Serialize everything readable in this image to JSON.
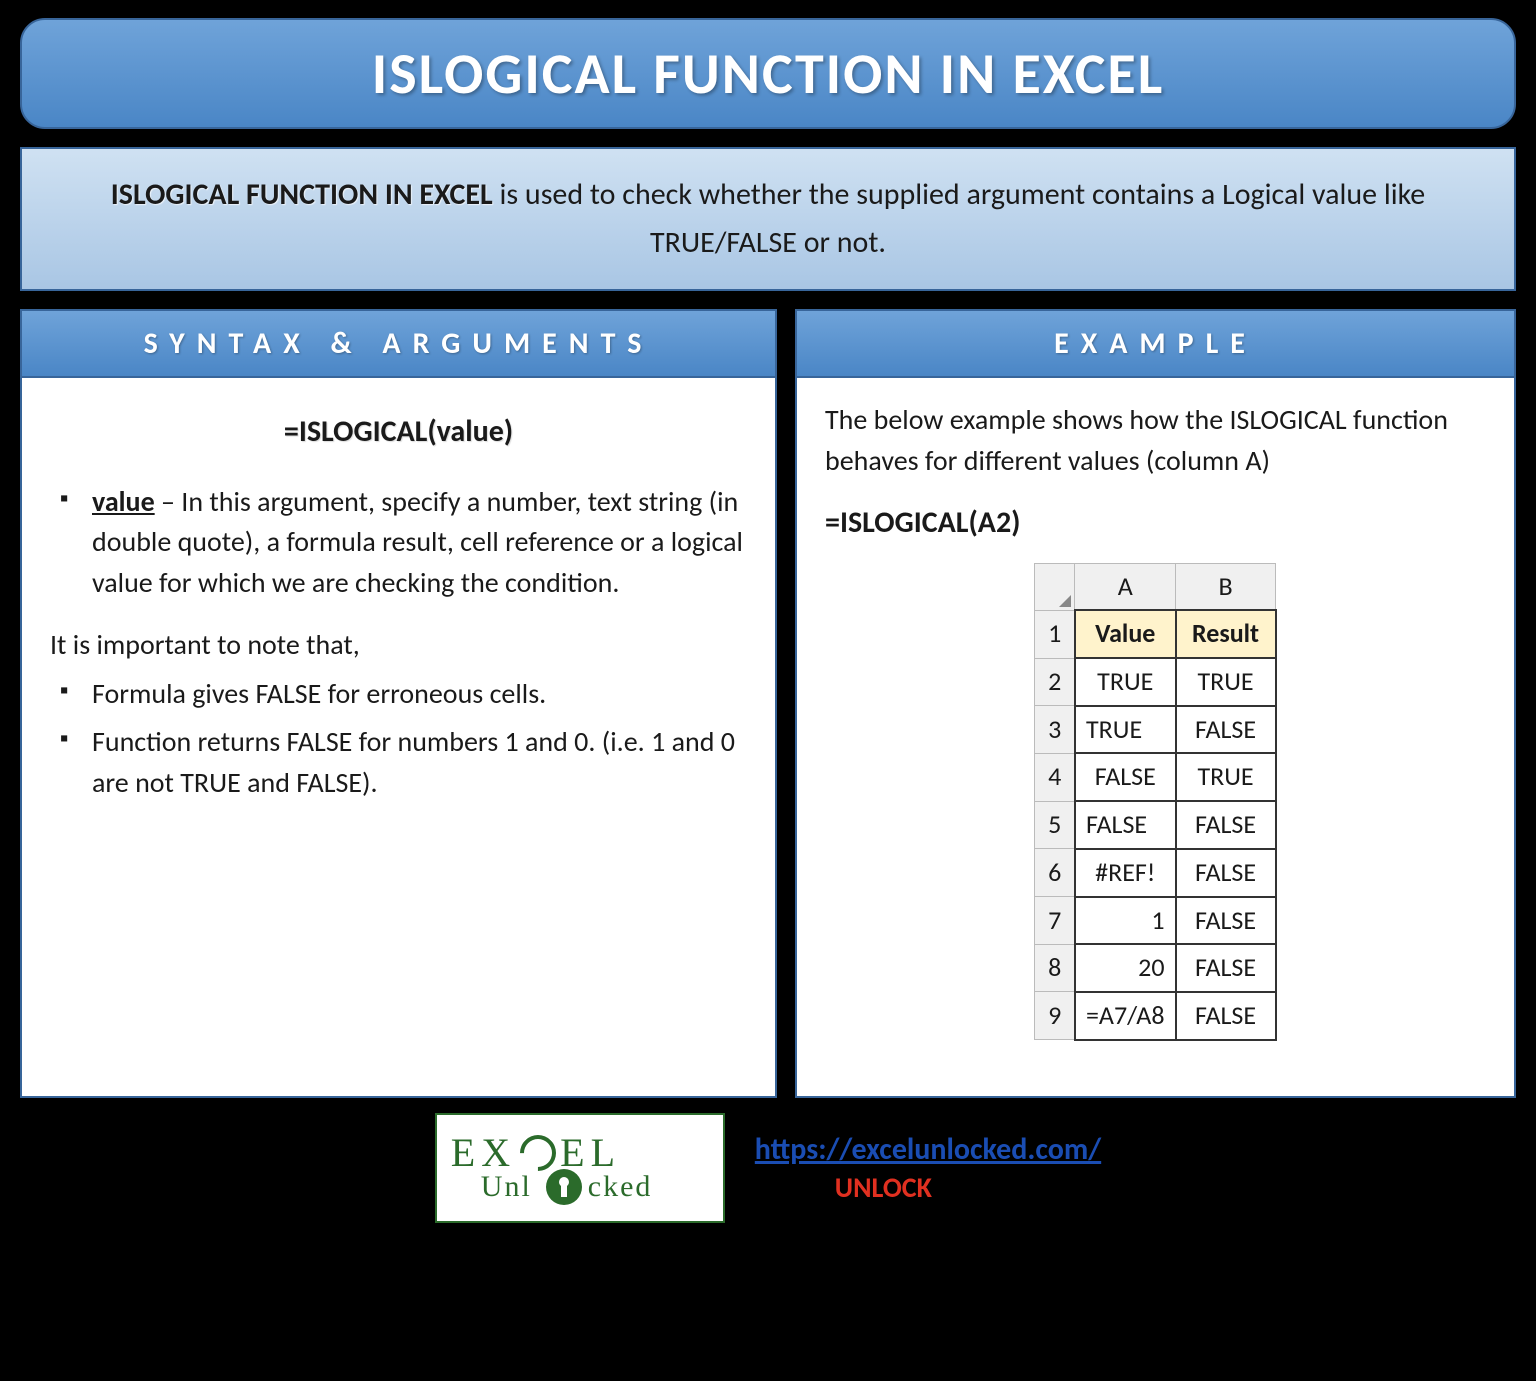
{
  "title": "ISLOGICAL FUNCTION IN EXCEL",
  "intro": {
    "strong": "ISLOGICAL FUNCTION IN EXCEL",
    "rest": " is used to check whether the supplied argument contains a Logical value like TRUE/FALSE or not."
  },
  "left": {
    "header": "SYNTAX & ARGUMENTS",
    "syntax": "=ISLOGICAL(value)",
    "arg_label": "value",
    "arg_desc": " – In this argument, specify a number, text string (in double quote), a formula result, cell reference or a logical value for which we are checking the condition.",
    "note_intro": "It is important to note that,",
    "notes": [
      "Formula gives FALSE for erroneous cells.",
      "Function returns FALSE for numbers 1 and 0. (i.e. 1 and 0 are not TRUE and FALSE)."
    ]
  },
  "right": {
    "header": "EXAMPLE",
    "intro": "The below example shows how the ISLOGICAL function behaves for different values (column A)",
    "formula": "=ISLOGICAL(A2)",
    "table": {
      "col_a": "A",
      "col_b": "B",
      "h_value": "Value",
      "h_result": "Result",
      "rows": [
        {
          "n": "1"
        },
        {
          "n": "2",
          "a": "TRUE",
          "b": "TRUE",
          "al": "center"
        },
        {
          "n": "3",
          "a": "TRUE",
          "b": "FALSE",
          "al": "left"
        },
        {
          "n": "4",
          "a": "FALSE",
          "b": "TRUE",
          "al": "center"
        },
        {
          "n": "5",
          "a": "FALSE",
          "b": "FALSE",
          "al": "left"
        },
        {
          "n": "6",
          "a": "#REF!",
          "b": "FALSE",
          "al": "center"
        },
        {
          "n": "7",
          "a": "1",
          "b": "FALSE",
          "al": "right"
        },
        {
          "n": "8",
          "a": "20",
          "b": "FALSE",
          "al": "right"
        },
        {
          "n": "9",
          "a": "=A7/A8",
          "b": "FALSE",
          "al": "left"
        }
      ]
    }
  },
  "footer": {
    "logo_top": "EX EL",
    "logo_bottom": "Unl  cked",
    "url": "https://excelunlocked.com/",
    "unlock": "UNLOCK"
  }
}
